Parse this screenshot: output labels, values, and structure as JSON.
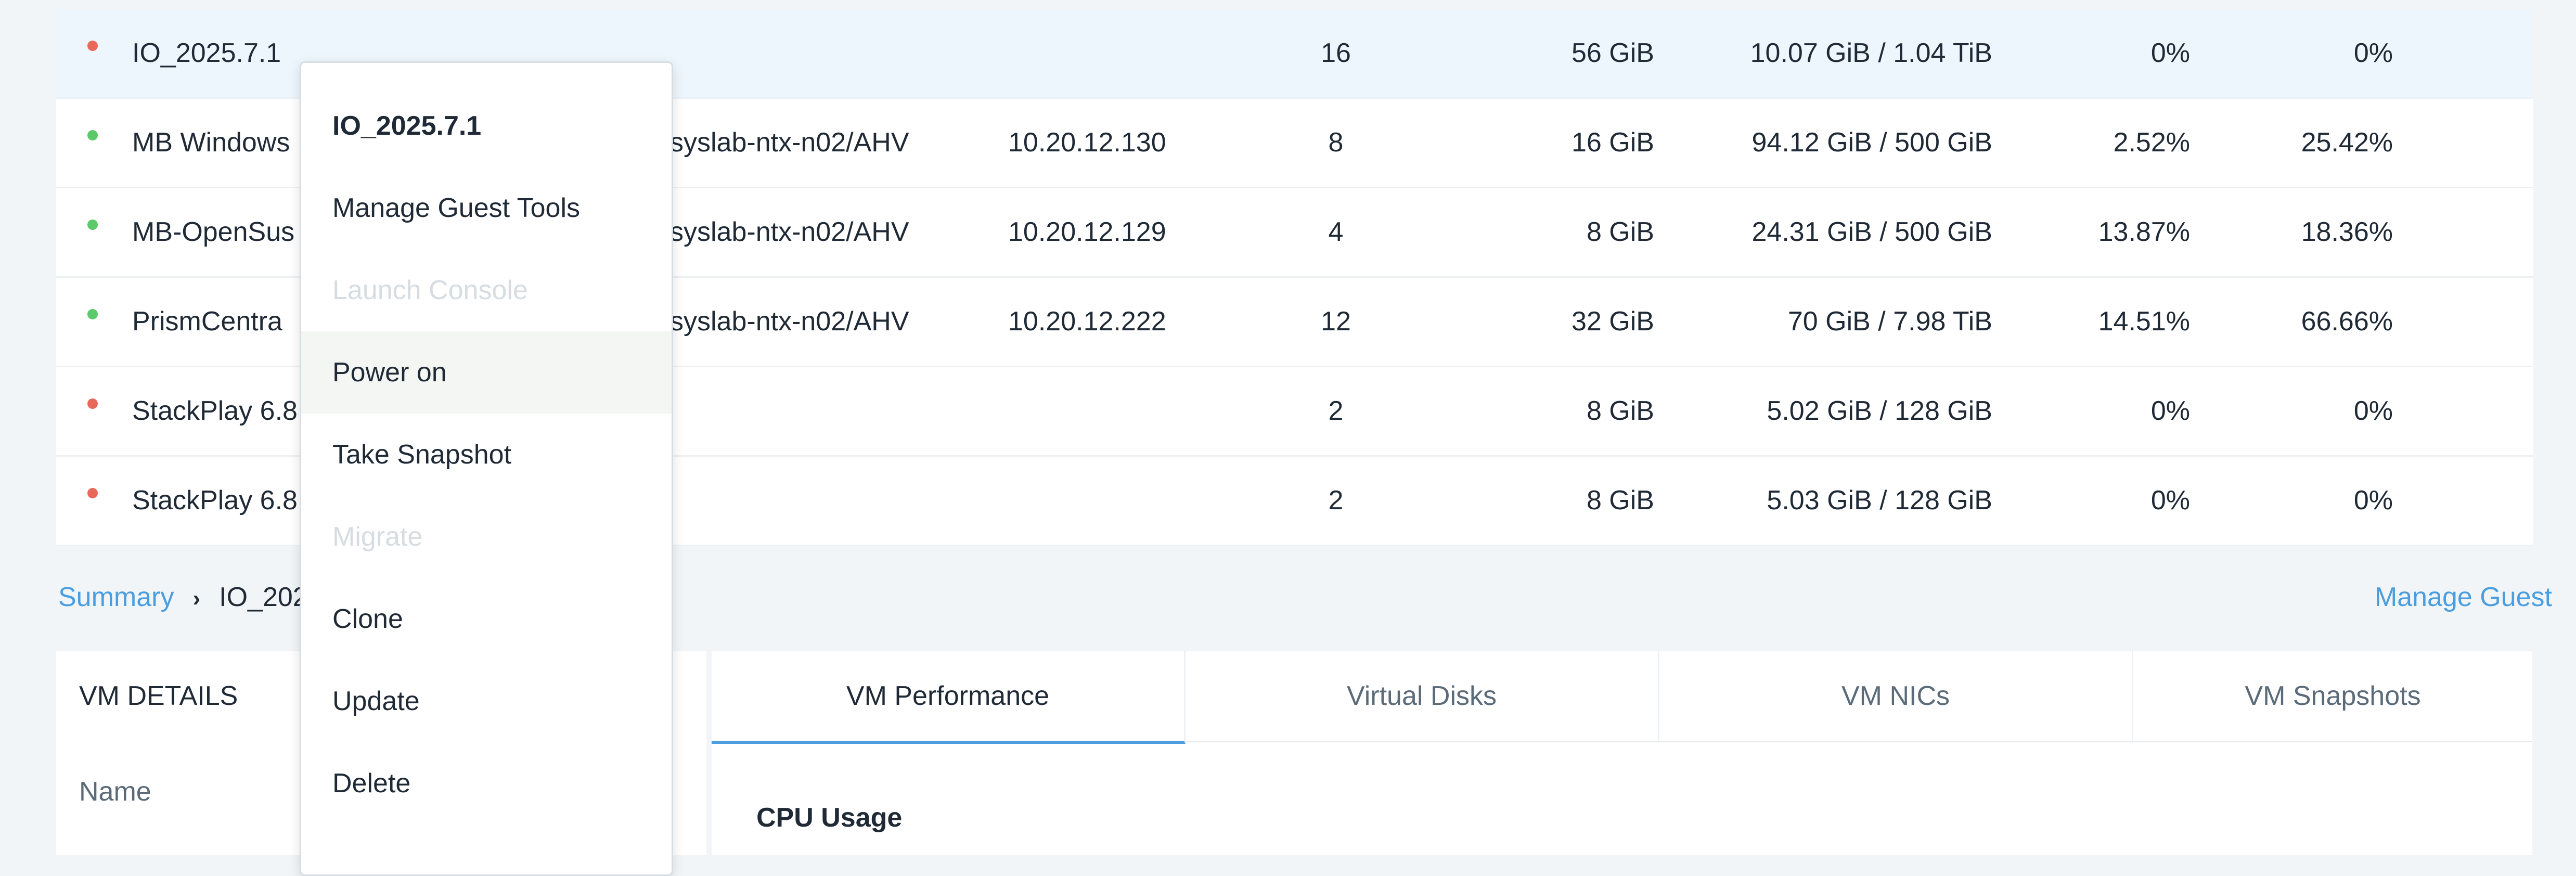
{
  "vm_table": {
    "rows": [
      {
        "status": "off",
        "name": "IO_2025.7.1",
        "host": "",
        "ip": "",
        "cores": "16",
        "memory": "56 GiB",
        "storage": "10.07 GiB / 1.04 TiB",
        "cpu_usage": "0%",
        "mem_usage": "0%"
      },
      {
        "status": "on",
        "name": "MB Windows",
        "host": "syslab-ntx-n02/AHV",
        "ip": "10.20.12.130",
        "cores": "8",
        "memory": "16 GiB",
        "storage": "94.12 GiB / 500 GiB",
        "cpu_usage": "2.52%",
        "mem_usage": "25.42%"
      },
      {
        "status": "on",
        "name": "MB-OpenSus",
        "host": "syslab-ntx-n02/AHV",
        "ip": "10.20.12.129",
        "cores": "4",
        "memory": "8 GiB",
        "storage": "24.31 GiB / 500 GiB",
        "cpu_usage": "13.87%",
        "mem_usage": "18.36%"
      },
      {
        "status": "on",
        "name": "PrismCentra",
        "host": "syslab-ntx-n02/AHV",
        "ip": "10.20.12.222",
        "cores": "12",
        "memory": "32 GiB",
        "storage": "70 GiB / 7.98 TiB",
        "cpu_usage": "14.51%",
        "mem_usage": "66.66%"
      },
      {
        "status": "off",
        "name": "StackPlay 6.8",
        "host": "",
        "ip": "",
        "cores": "2",
        "memory": "8 GiB",
        "storage": "5.02 GiB / 128 GiB",
        "cpu_usage": "0%",
        "mem_usage": "0%"
      },
      {
        "status": "off",
        "name": "StackPlay 6.8",
        "host": "",
        "ip": "",
        "cores": "2",
        "memory": "8 GiB",
        "storage": "5.03 GiB / 128 GiB",
        "cpu_usage": "0%",
        "mem_usage": "0%"
      }
    ]
  },
  "colors": {
    "status_on": "#5cc96a",
    "status_off": "#e8685a",
    "accent": "#4a9ee0",
    "selected_row": "#eef6fd"
  },
  "breadcrumb": {
    "root": "Summary",
    "separator": "›",
    "current": "IO_2025.7.1"
  },
  "header_links": {
    "manage_guest": "Manage Guest"
  },
  "vm_details": {
    "title": "VM DETAILS",
    "name_label": "Name"
  },
  "tabs": [
    {
      "label": "VM Performance",
      "active": true
    },
    {
      "label": "Virtual Disks",
      "active": false
    },
    {
      "label": "VM NICs",
      "active": false
    },
    {
      "label": "VM Snapshots",
      "active": false
    }
  ],
  "performance": {
    "section_title": "CPU Usage"
  },
  "context_menu": {
    "title": "IO_2025.7.1",
    "items": [
      {
        "label": "Manage Guest Tools",
        "enabled": true
      },
      {
        "label": "Launch Console",
        "enabled": false
      },
      {
        "label": "Power on",
        "enabled": true,
        "hovered": true
      },
      {
        "label": "Take Snapshot",
        "enabled": true
      },
      {
        "label": "Migrate",
        "enabled": false
      },
      {
        "label": "Clone",
        "enabled": true
      },
      {
        "label": "Update",
        "enabled": true
      },
      {
        "label": "Delete",
        "enabled": true
      }
    ]
  }
}
